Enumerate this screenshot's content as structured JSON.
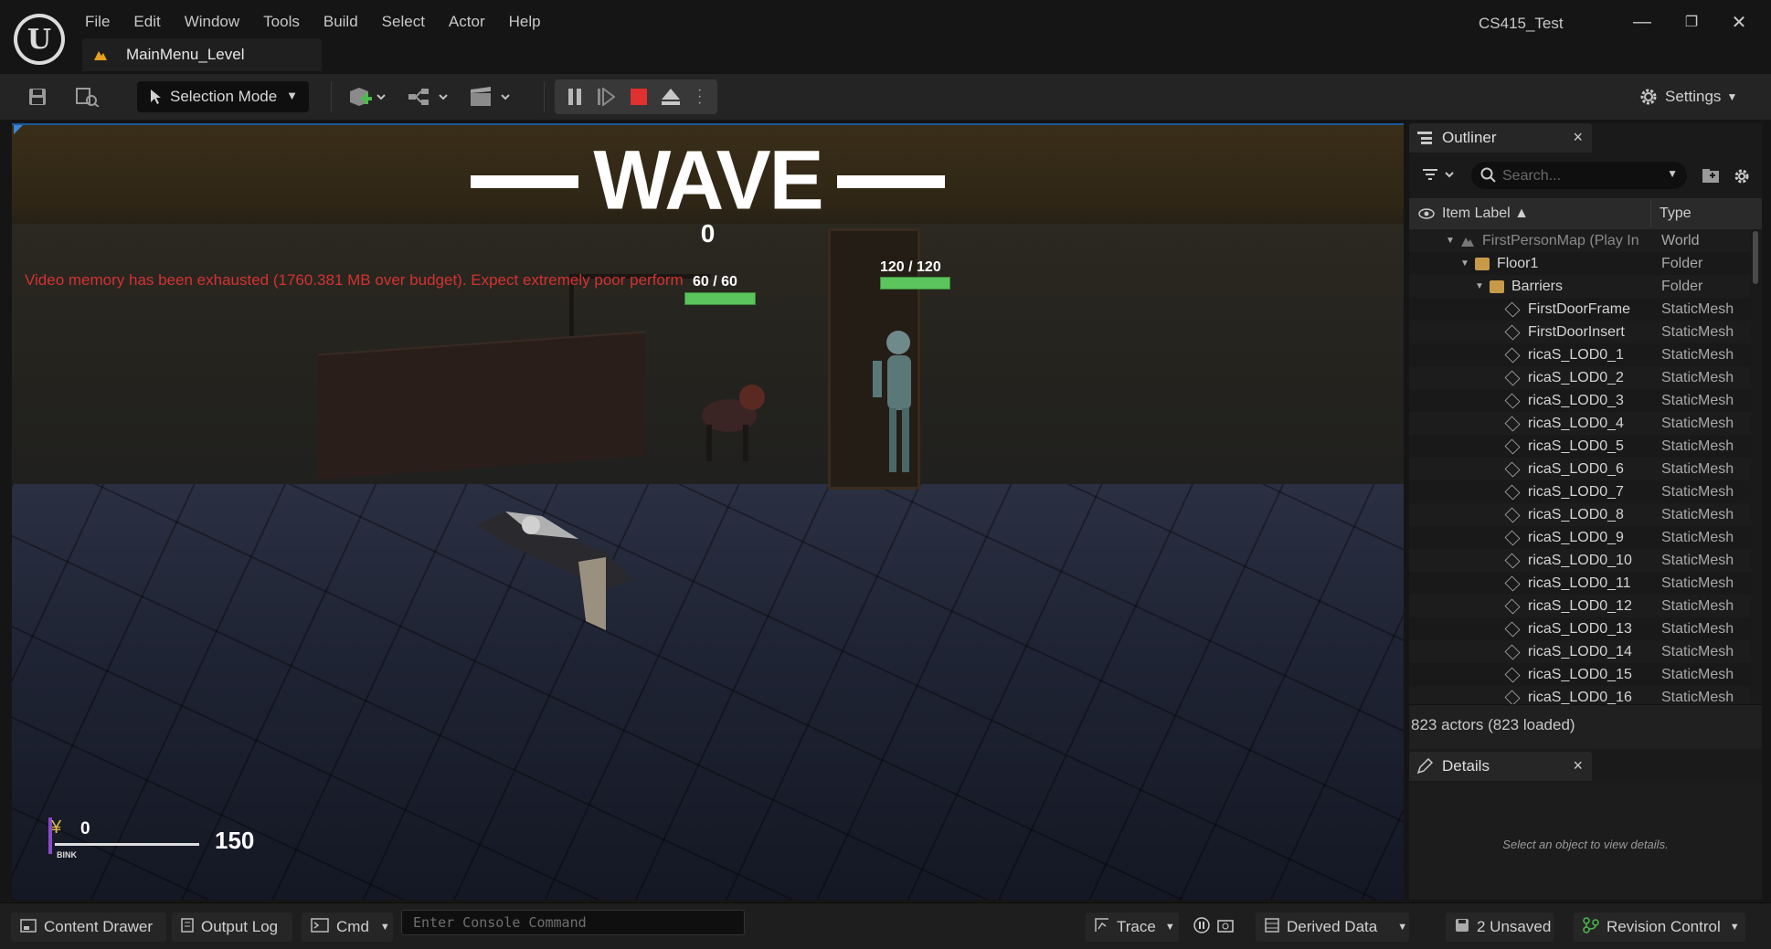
{
  "app": {
    "title": "CS415_Test",
    "level_tab": "MainMenu_Level"
  },
  "menu": [
    "File",
    "Edit",
    "Window",
    "Tools",
    "Build",
    "Select",
    "Actor",
    "Help"
  ],
  "window_controls": {
    "minimize": "—",
    "restore": "❐",
    "close": "✕"
  },
  "toolbar": {
    "selection_mode": "Selection Mode",
    "settings": "Settings"
  },
  "viewport": {
    "wave_title": "WAVE",
    "wave_number": "0",
    "warning": "Video memory has been exhausted (1760.381 MB over budget). Expect extremely poor perform",
    "enemy_hp_1": "60 / 60",
    "enemy_hp_2": "120 / 120",
    "currency": "0",
    "currency_label": "BINK",
    "ammo": "150"
  },
  "outliner": {
    "tab": "Outliner",
    "search_placeholder": "Search...",
    "col_label": "Item Label ▲",
    "col_type": "Type",
    "rows": [
      {
        "label": "FirstPersonMap (Play In",
        "type": "World"
      },
      {
        "label": "Floor1",
        "type": "Folder"
      },
      {
        "label": "Barriers",
        "type": "Folder"
      },
      {
        "label": "FirstDoorFrame",
        "type": "StaticMesh"
      },
      {
        "label": "FirstDoorInsert",
        "type": "StaticMesh"
      },
      {
        "label": "ricaS_LOD0_1",
        "type": "StaticMesh"
      },
      {
        "label": "ricaS_LOD0_2",
        "type": "StaticMesh"
      },
      {
        "label": "ricaS_LOD0_3",
        "type": "StaticMesh"
      },
      {
        "label": "ricaS_LOD0_4",
        "type": "StaticMesh"
      },
      {
        "label": "ricaS_LOD0_5",
        "type": "StaticMesh"
      },
      {
        "label": "ricaS_LOD0_6",
        "type": "StaticMesh"
      },
      {
        "label": "ricaS_LOD0_7",
        "type": "StaticMesh"
      },
      {
        "label": "ricaS_LOD0_8",
        "type": "StaticMesh"
      },
      {
        "label": "ricaS_LOD0_9",
        "type": "StaticMesh"
      },
      {
        "label": "ricaS_LOD0_10",
        "type": "StaticMesh"
      },
      {
        "label": "ricaS_LOD0_11",
        "type": "StaticMesh"
      },
      {
        "label": "ricaS_LOD0_12",
        "type": "StaticMesh"
      },
      {
        "label": "ricaS_LOD0_13",
        "type": "StaticMesh"
      },
      {
        "label": "ricaS_LOD0_14",
        "type": "StaticMesh"
      },
      {
        "label": "ricaS_LOD0_15",
        "type": "StaticMesh"
      },
      {
        "label": "ricaS_LOD0_16",
        "type": "StaticMesh"
      }
    ],
    "actor_count": "823 actors (823 loaded)"
  },
  "details": {
    "tab": "Details",
    "empty_msg": "Select an object to view details."
  },
  "statusbar": {
    "content_drawer": "Content Drawer",
    "output_log": "Output Log",
    "cmd": "Cmd",
    "console_placeholder": "Enter Console Command",
    "trace": "Trace",
    "derived_data": "Derived Data",
    "unsaved": "2 Unsaved",
    "revision_control": "Revision Control"
  },
  "colors": {
    "warning": "#d33232",
    "hp_bar": "#5cc45c",
    "accent": "#3d86d6"
  }
}
